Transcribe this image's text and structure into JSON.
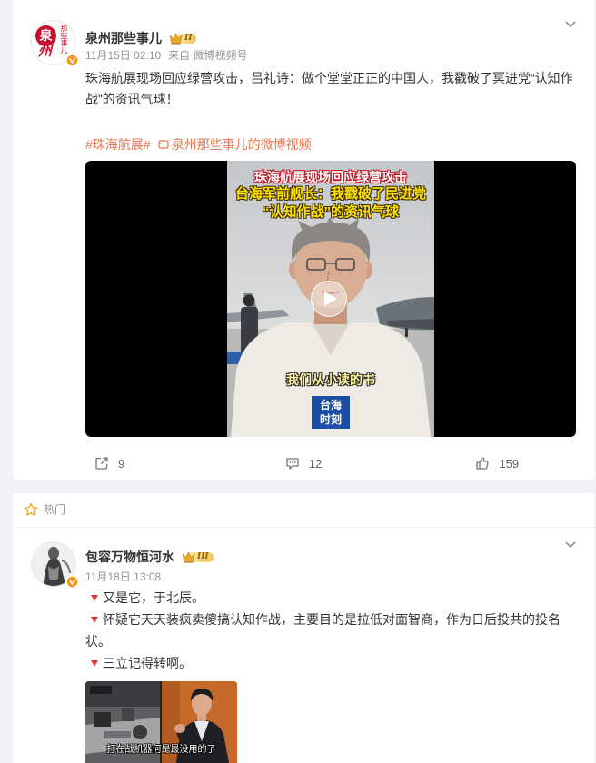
{
  "colors": {
    "page_bg": "#f1f2f5",
    "card_bg": "#ffffff",
    "text": "#333333",
    "muted": "#939393",
    "accent": "#eb7350",
    "hot_star": "#f5a623",
    "bullet": "#e0393e",
    "verified": "#f7941d",
    "level_gold": "#e6a92a"
  },
  "posts": [
    {
      "avatar": {
        "logo_char_1": "泉",
        "logo_char_2": "州",
        "logo_vertical": "那些事儿"
      },
      "verified_icon": "verified-badge-icon",
      "author": "泉州那些事儿",
      "level_badge": "II",
      "menu_icon": "chevron-down-icon",
      "time": "11月15日 02:10",
      "source": "来自 微博视频号",
      "text": "珠海航展现场回应绿营攻击，吕礼诗：做个堂堂正正的中国人，我戳破了冥进党“认知作战”的资讯气球！",
      "topic": "#珠海航展#",
      "video_link_icon": "video-icon",
      "video_link_label": "泉州那些事儿的微博视频",
      "video": {
        "title_line1": "珠海航展现场回应绿营攻击",
        "title_line2": "台海军前舰长：我戳破了民进党",
        "title_line3": "“认知作战”的资讯气球",
        "subtitle": "我们从小读的书",
        "logo_line1": "台海",
        "logo_line2": "时刻",
        "play_icon": "play-icon"
      },
      "actions": [
        {
          "icon": "share-icon",
          "count": "9"
        },
        {
          "icon": "comment-icon",
          "count": "12"
        },
        {
          "icon": "like-icon",
          "count": "159"
        }
      ]
    },
    {
      "section_icon": "star-icon",
      "section_label": "热门",
      "verified_icon": "verified-badge-icon",
      "author": "包容万物恒河水",
      "level_badge": "III",
      "menu_icon": "chevron-down-icon",
      "time": "11月18日 13:08",
      "bullet_icon": "red-down-triangle-icon",
      "lines": [
        "又是它，于北辰。",
        "怀疑它天天装疯卖傻搞认知作战，主要目的是拉低对面智商，作为日后投共的投名状。",
        "三立记得转啊。"
      ],
      "image": {
        "caption": "打在战机器何是最没用的了"
      }
    }
  ]
}
